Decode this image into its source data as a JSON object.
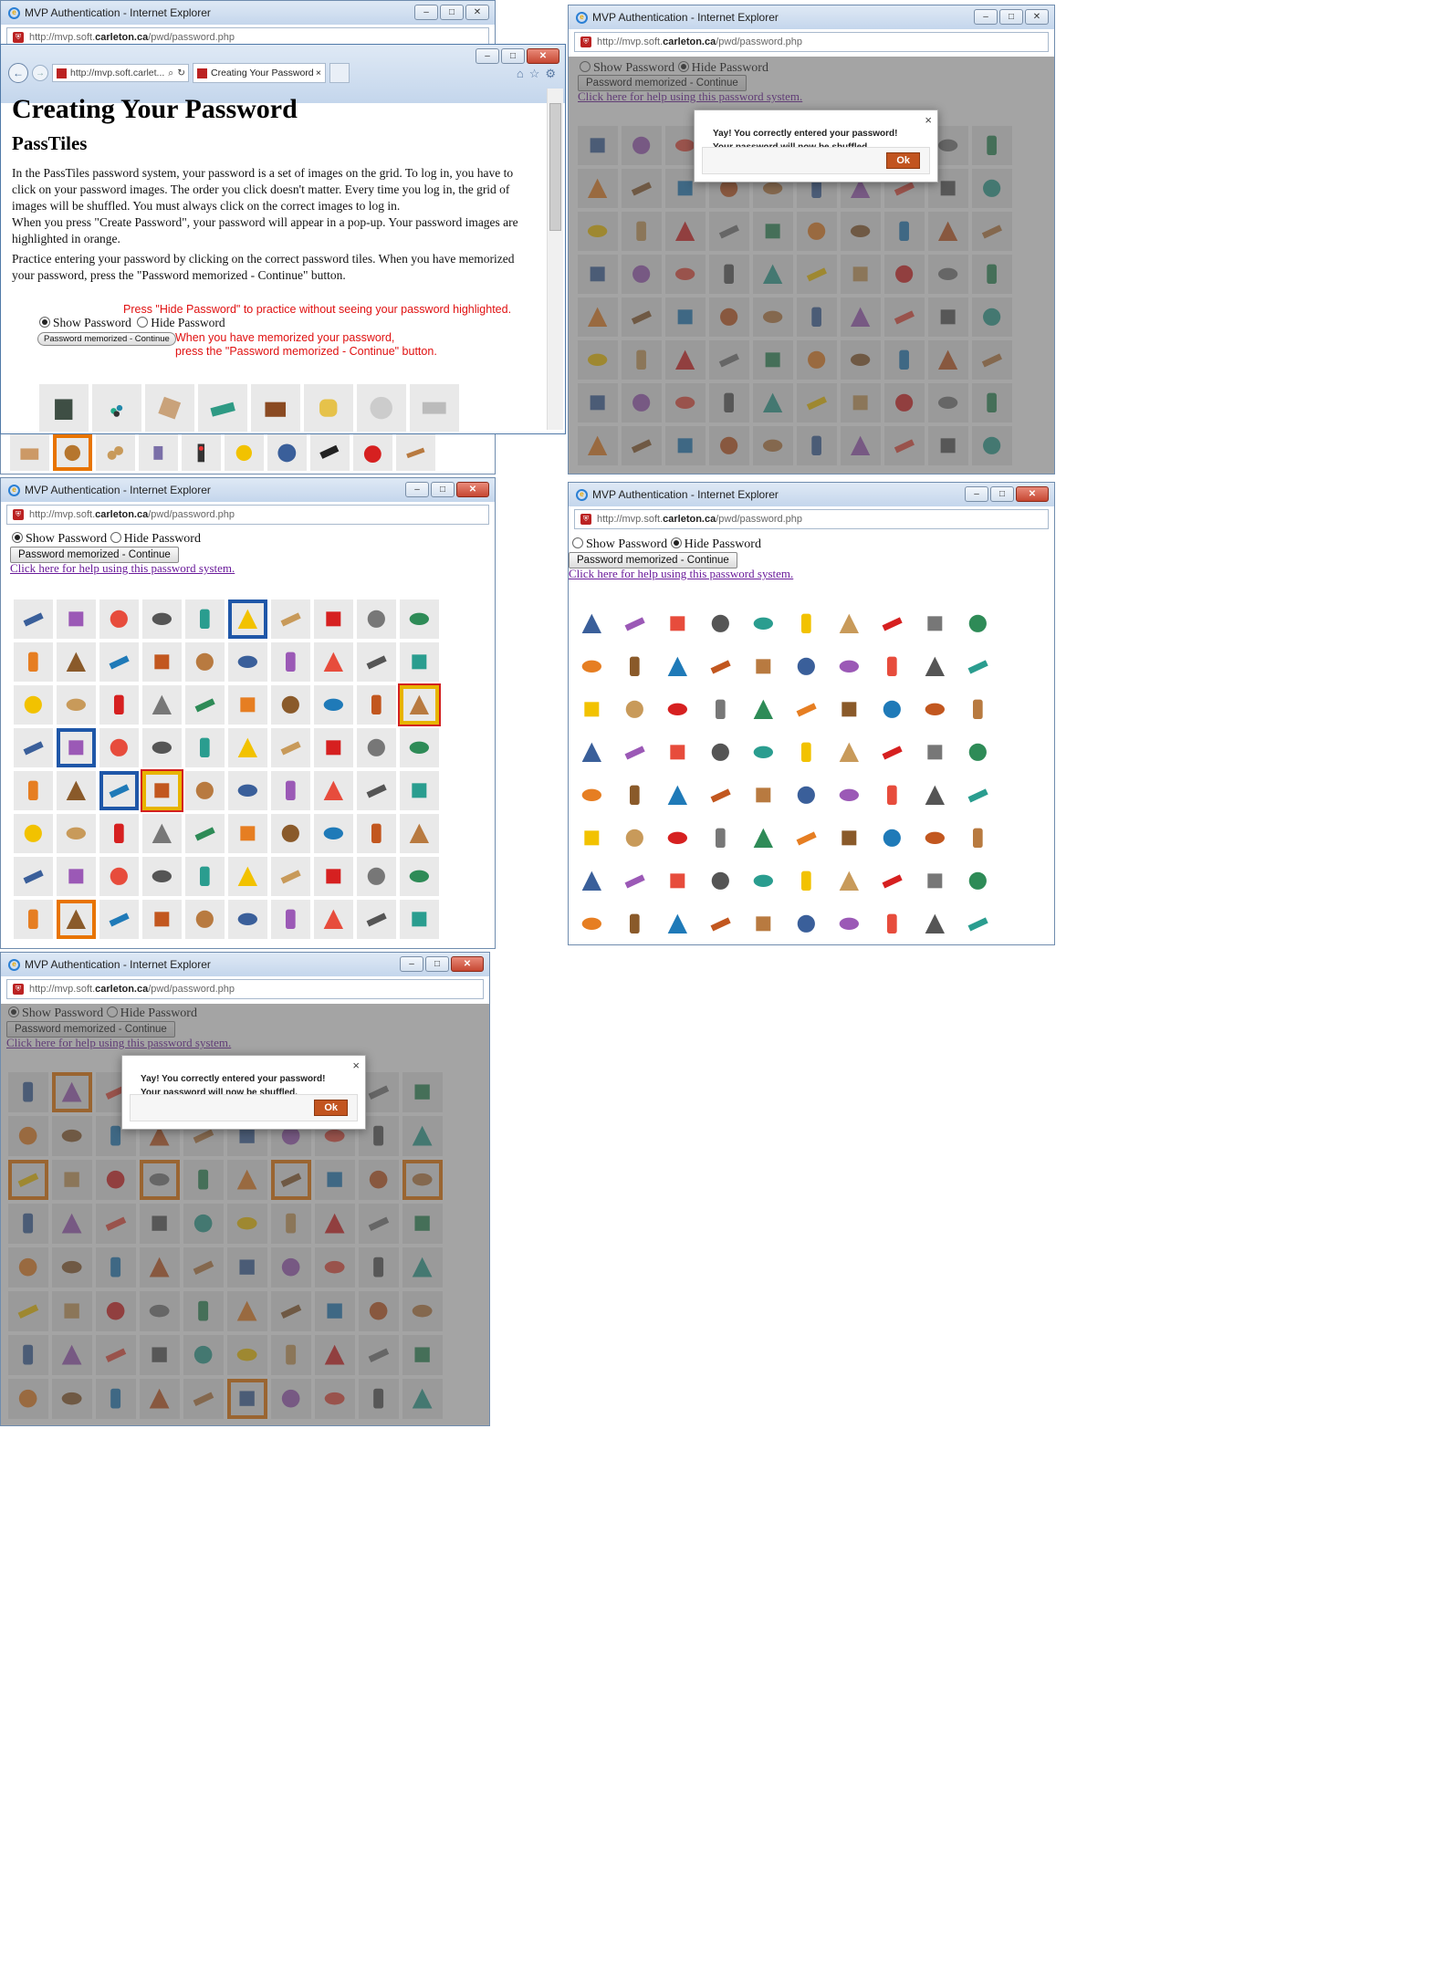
{
  "windows": {
    "title": "MVP Authentication - Internet Explorer",
    "url_prefix": "http://mvp.soft.",
    "url_domain": "carleton.ca",
    "url_path": "/pwd/password.php"
  },
  "browser_front": {
    "url_short": "http://mvp.soft.carlet...",
    "tab_label": "Creating Your Password"
  },
  "page": {
    "heading": "Creating Your Password",
    "subheading": "PassTiles",
    "para1": "In the PassTiles password system, your password is a set of images on the grid. To log in, you have to click on your password images. The order you click doesn't matter. Every time you log in, the grid of images will be shuffled. You must always click on the correct images to log in.",
    "para2": "When you press \"Create Password\", your password will appear in a pop-up. Your password images are highlighted in orange.",
    "para3": "Practice entering your password by clicking on the correct password tiles. When you have memorized your password, press the \"Password memorized - Continue\" button.",
    "note_hide": "Press \"Hide Password\" to practice without seeing your password highlighted.",
    "note_continue_1": "When you have memorized your password,",
    "note_continue_2": "press the \"Password memorized - Continue\" button."
  },
  "controls": {
    "show_label": "Show Password",
    "hide_label": "Hide Password",
    "continue_label": "Password memorized - Continue",
    "help_link": "Click here for help using this password system."
  },
  "dialog": {
    "message": "Yay! You correctly entered your password! Your password will now be shuffled.",
    "ok": "Ok",
    "close": "×"
  },
  "colors": {
    "highlight": "#e87400",
    "selected_blue": "#1f57a8",
    "link": "#6a1b9a",
    "note_red": "#e01010"
  }
}
